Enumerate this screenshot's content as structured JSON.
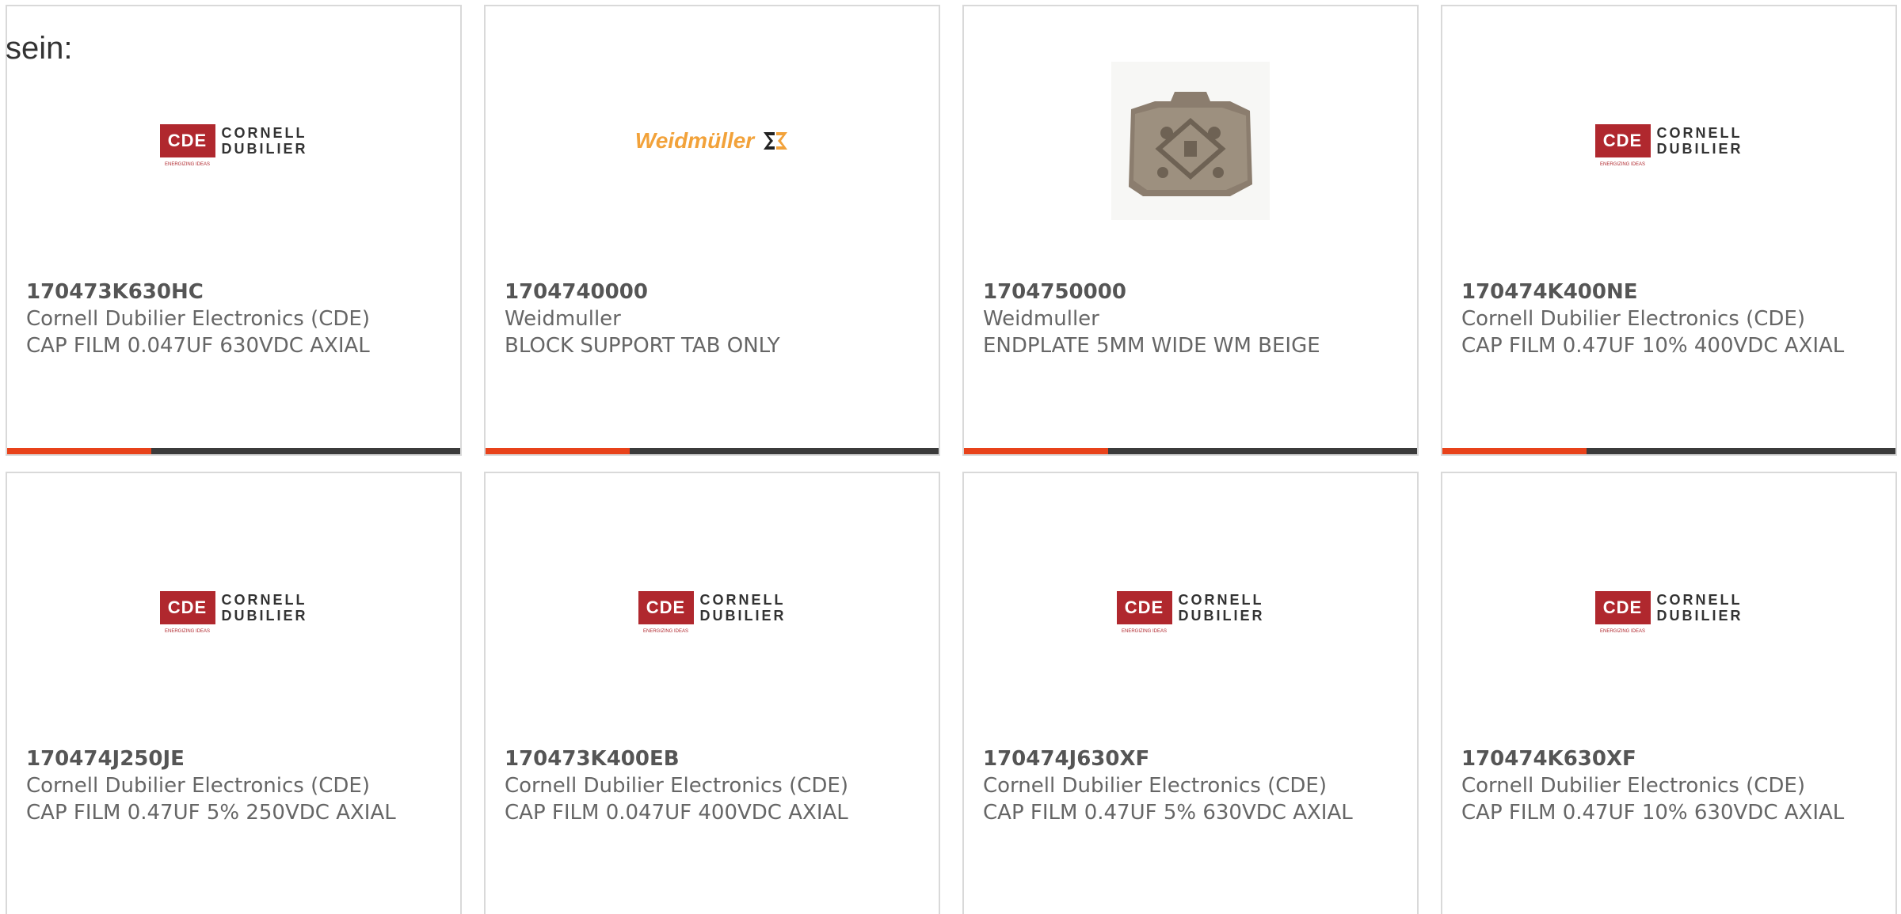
{
  "intro_text": "sein:",
  "brand_colors": {
    "accent_bar": "#e8421a",
    "bar_dark": "#3b3b3b",
    "cde_red": "#b0282e",
    "weidmuller_orange": "#f2a23a"
  },
  "products": [
    {
      "part_number": "170473K630HC",
      "manufacturer": "Cornell Dubilier Electronics (CDE)",
      "description": "CAP FILM 0.047UF 630VDC AXIAL",
      "image": "cde-logo",
      "logo": {
        "mark": "CDE",
        "line1": "CORNELL",
        "line2": "DUBILIER",
        "tagline": "ENERGIZING IDEAS"
      }
    },
    {
      "part_number": "1704740000",
      "manufacturer": "Weidmuller",
      "description": "BLOCK SUPPORT TAB ONLY",
      "image": "weidmuller-logo",
      "logo": {
        "mark": "Weidmüller"
      }
    },
    {
      "part_number": "1704750000",
      "manufacturer": "Weidmuller",
      "description": "ENDPLATE 5MM WIDE WM BEIGE",
      "image": "endplate-photo"
    },
    {
      "part_number": "170474K400NE",
      "manufacturer": "Cornell Dubilier Electronics (CDE)",
      "description": "CAP FILM 0.47UF 10% 400VDC AXIAL",
      "image": "cde-logo",
      "logo": {
        "mark": "CDE",
        "line1": "CORNELL",
        "line2": "DUBILIER",
        "tagline": "ENERGIZING IDEAS"
      }
    },
    {
      "part_number": "170474J250JE",
      "manufacturer": "Cornell Dubilier Electronics (CDE)",
      "description": "CAP FILM 0.47UF 5% 250VDC AXIAL",
      "image": "cde-logo",
      "logo": {
        "mark": "CDE",
        "line1": "CORNELL",
        "line2": "DUBILIER",
        "tagline": "ENERGIZING IDEAS"
      }
    },
    {
      "part_number": "170473K400EB",
      "manufacturer": "Cornell Dubilier Electronics (CDE)",
      "description": "CAP FILM 0.047UF 400VDC AXIAL",
      "image": "cde-logo",
      "logo": {
        "mark": "CDE",
        "line1": "CORNELL",
        "line2": "DUBILIER",
        "tagline": "ENERGIZING IDEAS"
      }
    },
    {
      "part_number": "170474J630XF",
      "manufacturer": "Cornell Dubilier Electronics (CDE)",
      "description": "CAP FILM 0.47UF 5% 630VDC AXIAL",
      "image": "cde-logo",
      "logo": {
        "mark": "CDE",
        "line1": "CORNELL",
        "line2": "DUBILIER",
        "tagline": "ENERGIZING IDEAS"
      }
    },
    {
      "part_number": "170474K630XF",
      "manufacturer": "Cornell Dubilier Electronics (CDE)",
      "description": "CAP FILM 0.47UF 10% 630VDC AXIAL",
      "image": "cde-logo",
      "logo": {
        "mark": "CDE",
        "line1": "CORNELL",
        "line2": "DUBILIER",
        "tagline": "ENERGIZING IDEAS"
      }
    }
  ]
}
